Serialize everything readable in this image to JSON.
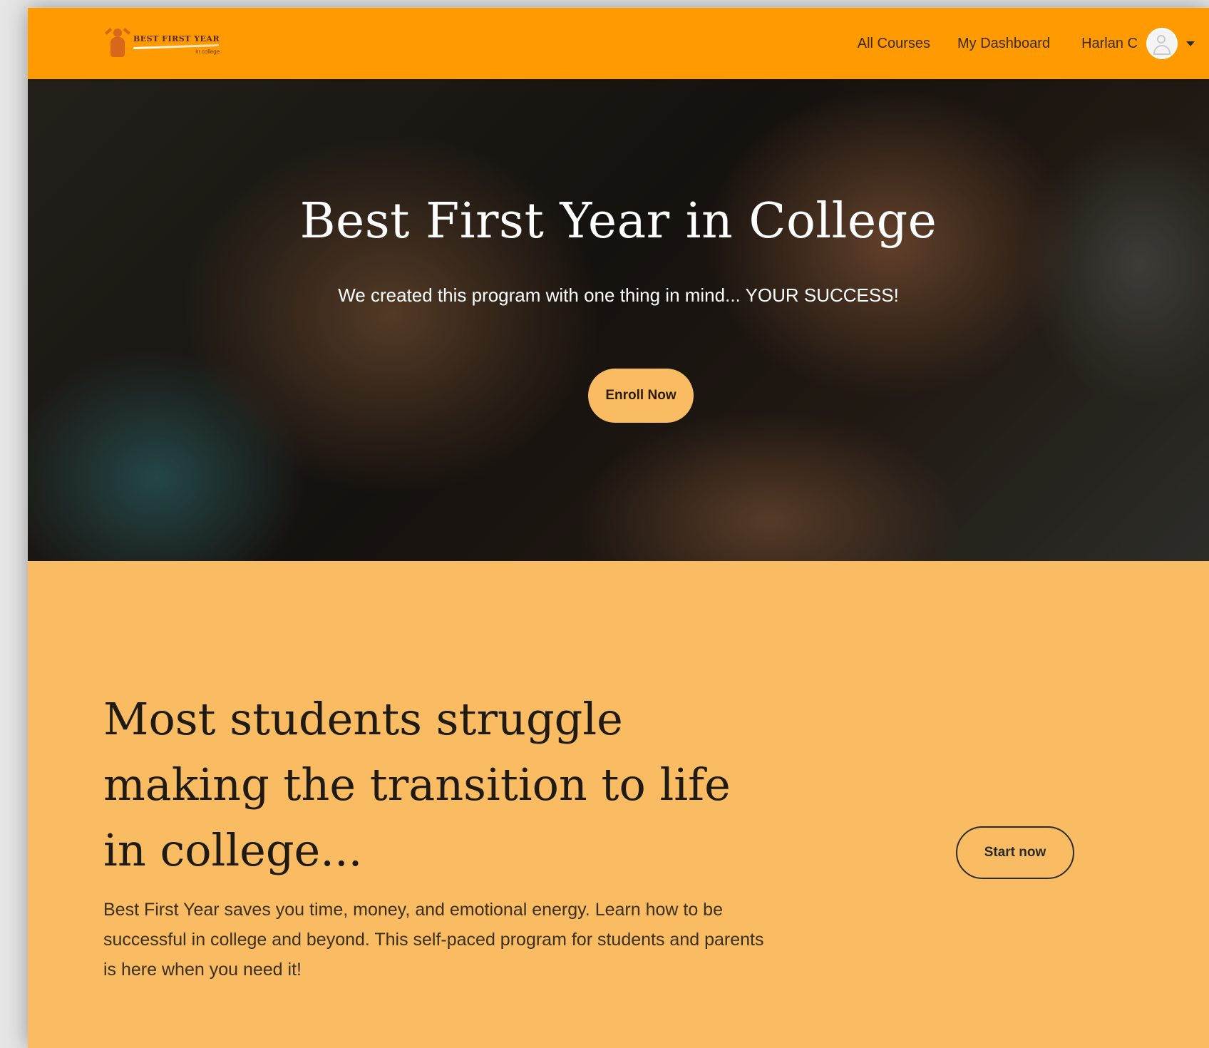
{
  "brand": {
    "logo_title": "BEST FIRST YEAR",
    "logo_subtitle": "in college",
    "primary_color": "#FF9A00",
    "section_color": "#F9BC63"
  },
  "nav": {
    "links": [
      "All Courses",
      "My Dashboard"
    ],
    "user_name": "Harlan C"
  },
  "hero": {
    "title": "Best First Year in College",
    "subtitle": "We created this program with one thing in mind... YOUR SUCCESS!",
    "cta_label": "Enroll Now"
  },
  "intro": {
    "heading": "Most students struggle making the transition to life in college...",
    "body": "Best First Year saves you time, money, and emotional energy. Learn how to be successful in college and beyond. This self-paced program for students and parents is here when you need it!",
    "cta_label": "Start now"
  }
}
